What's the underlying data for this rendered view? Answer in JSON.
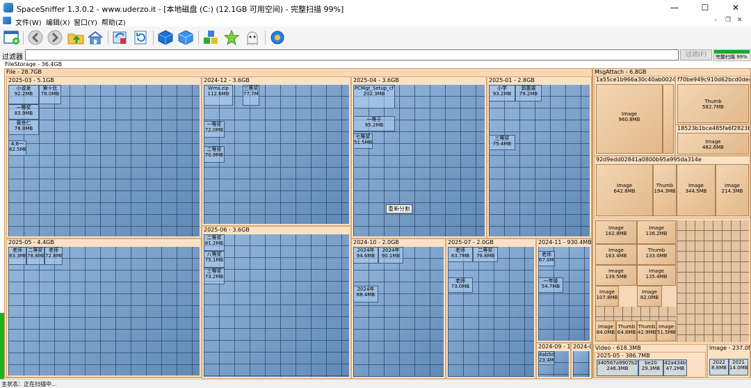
{
  "window": {
    "title": "SpaceSniffer 1.3.0.2 - www.uderzo.it - [本地磁盘 (C:) (12.1GB 可用空间) - 完整扫描 99%]"
  },
  "menu": {
    "items": [
      "文件(W)",
      "编辑(X)",
      "窗口(Y)",
      "帮助(Z)"
    ]
  },
  "filter": {
    "label": "过滤器",
    "value": "",
    "button": "过滤(F)"
  },
  "scan": {
    "label": "完整扫描 99%",
    "progress": 0.99
  },
  "map": {
    "root": "FileStorage - 36.4GB",
    "file": {
      "label": "File - 28.7GB",
      "groups": [
        {
          "label": "2025-03 - 5.1GB",
          "samples": [
            [
              "小说发",
              "92.2MB"
            ],
            [
              "第十比",
              "78.0MB"
            ],
            [
              "一等奖",
              "83.9MB"
            ],
            [
              "黄世仁",
              "78.8MB"
            ],
            [
              "4.8一",
              "62.5MB"
            ]
          ]
        },
        {
          "label": "2024-12 - 3.6GB",
          "samples": [
            [
              "Wms.zip",
              "112.6MB"
            ],
            [
              "三等奖",
              "77.7MB"
            ],
            [
              "一等奖",
              "72.0MB"
            ],
            [
              "二等奖",
              "70.9MB"
            ]
          ]
        },
        {
          "label": "2025-04 - 3.6GB",
          "samples": [
            [
              "PCMgr_Setup_cf",
              "202.3MB"
            ],
            [
              "一等于",
              "95.2MB"
            ],
            [
              "七等奖",
              "51.5MB"
            ]
          ]
        },
        {
          "label": "2025-01 - 2.8GB",
          "samples": [
            [
              "小学",
              "93.2MB"
            ],
            [
              "郭惠雯",
              "79.2MB"
            ],
            [
              "三等奖",
              "75.4MB"
            ]
          ]
        },
        {
          "label": "2025-06 - 3.6GB",
          "samples": [
            [
              "二等奖",
              "81.2MB"
            ],
            [
              "八等奖",
              "75.1MB"
            ],
            [
              "三等奖",
              "73.2MB"
            ]
          ]
        },
        {
          "label": "2025-05 - 4.4GB",
          "samples": [
            [
              "老师",
              "83.3MB"
            ],
            [
              "二等奖",
              "78.8MB"
            ],
            [
              "老师",
              "72.8MB"
            ]
          ]
        },
        {
          "label": "2024-10 - 2.0GB",
          "samples": [
            [
              "2024年",
              "94.6MB"
            ],
            [
              "2024年",
              "90.1MB"
            ],
            [
              "2024年",
              "88.4MB"
            ]
          ]
        },
        {
          "label": "2025-07 - 2.0GB",
          "samples": [
            [
              "老师",
              "83.7MB"
            ],
            [
              "二等奖",
              "79.8MB"
            ],
            [
              "老师",
              "73.0MB"
            ]
          ]
        },
        {
          "label": "2024-11 - 930.4MB",
          "samples": [
            [
              "老师",
              "67.0MB"
            ],
            [
              "一年级",
              "54.7MB"
            ]
          ]
        },
        {
          "label": "2024-09 - 173.2MB",
          "samples": [
            [
              "8ab5d",
              "23.4MB"
            ]
          ]
        },
        {
          "label": "2024-08 - ",
          "samples": []
        }
      ]
    },
    "msg": {
      "label": "MsgAttach - 6.8GB",
      "hashes": [
        "1a55ce1b966a30c40ab002460417456",
        "f70be949c910d62bcd0dee1452b8",
        "18523b1bce485fa6f2823b3a7e78",
        "92d9edd02841a0800b95a995da314e"
      ],
      "items": [
        {
          "label": "Image",
          "size": "960.8MB"
        },
        {
          "label": "Thumb",
          "size": "582.7MB"
        },
        {
          "label": "Image",
          "size": "482.6MB"
        },
        {
          "label": "Image",
          "size": "642.8MB"
        },
        {
          "label": "Thumb",
          "size": "194.3MB"
        },
        {
          "label": "Image",
          "size": "344.5MB"
        },
        {
          "label": "Image",
          "size": "214.3MB"
        },
        {
          "label": "Image",
          "size": "162.8MB"
        },
        {
          "label": "Image",
          "size": "136.2MB"
        },
        {
          "label": "Image",
          "size": "163.4MB"
        },
        {
          "label": "Thumb",
          "size": "133.0MB"
        },
        {
          "label": "Image",
          "size": "139.5MB"
        },
        {
          "label": "Image",
          "size": "135.4MB"
        },
        {
          "label": "Image",
          "size": "107.8MB"
        },
        {
          "label": "Image",
          "size": "82.0MB"
        },
        {
          "label": "Image",
          "size": "84.0MB"
        },
        {
          "label": "Thumb",
          "size": "64.8MB"
        },
        {
          "label": "Thumb",
          "size": "42.9MB"
        },
        {
          "label": "Image",
          "size": "51.5MB"
        }
      ]
    },
    "video": {
      "label": "Video - 618.3MB",
      "sub": "2025-05 - 386.7MB",
      "items": [
        {
          "label": "340567a9907b207c",
          "size": "246.3MB"
        },
        {
          "label": "be20",
          "size": "29.3MB"
        },
        {
          "label": "42a434b",
          "size": "47.2MB"
        }
      ]
    },
    "image": {
      "label": "Image - 237.0MB",
      "items": [
        {
          "label": "2022",
          "size": "8.8MB"
        },
        {
          "label": "2021",
          "size": "14.0MB"
        }
      ]
    },
    "tooltip": "重新分割"
  },
  "status": {
    "text": "主状态：正在扫描中..."
  }
}
